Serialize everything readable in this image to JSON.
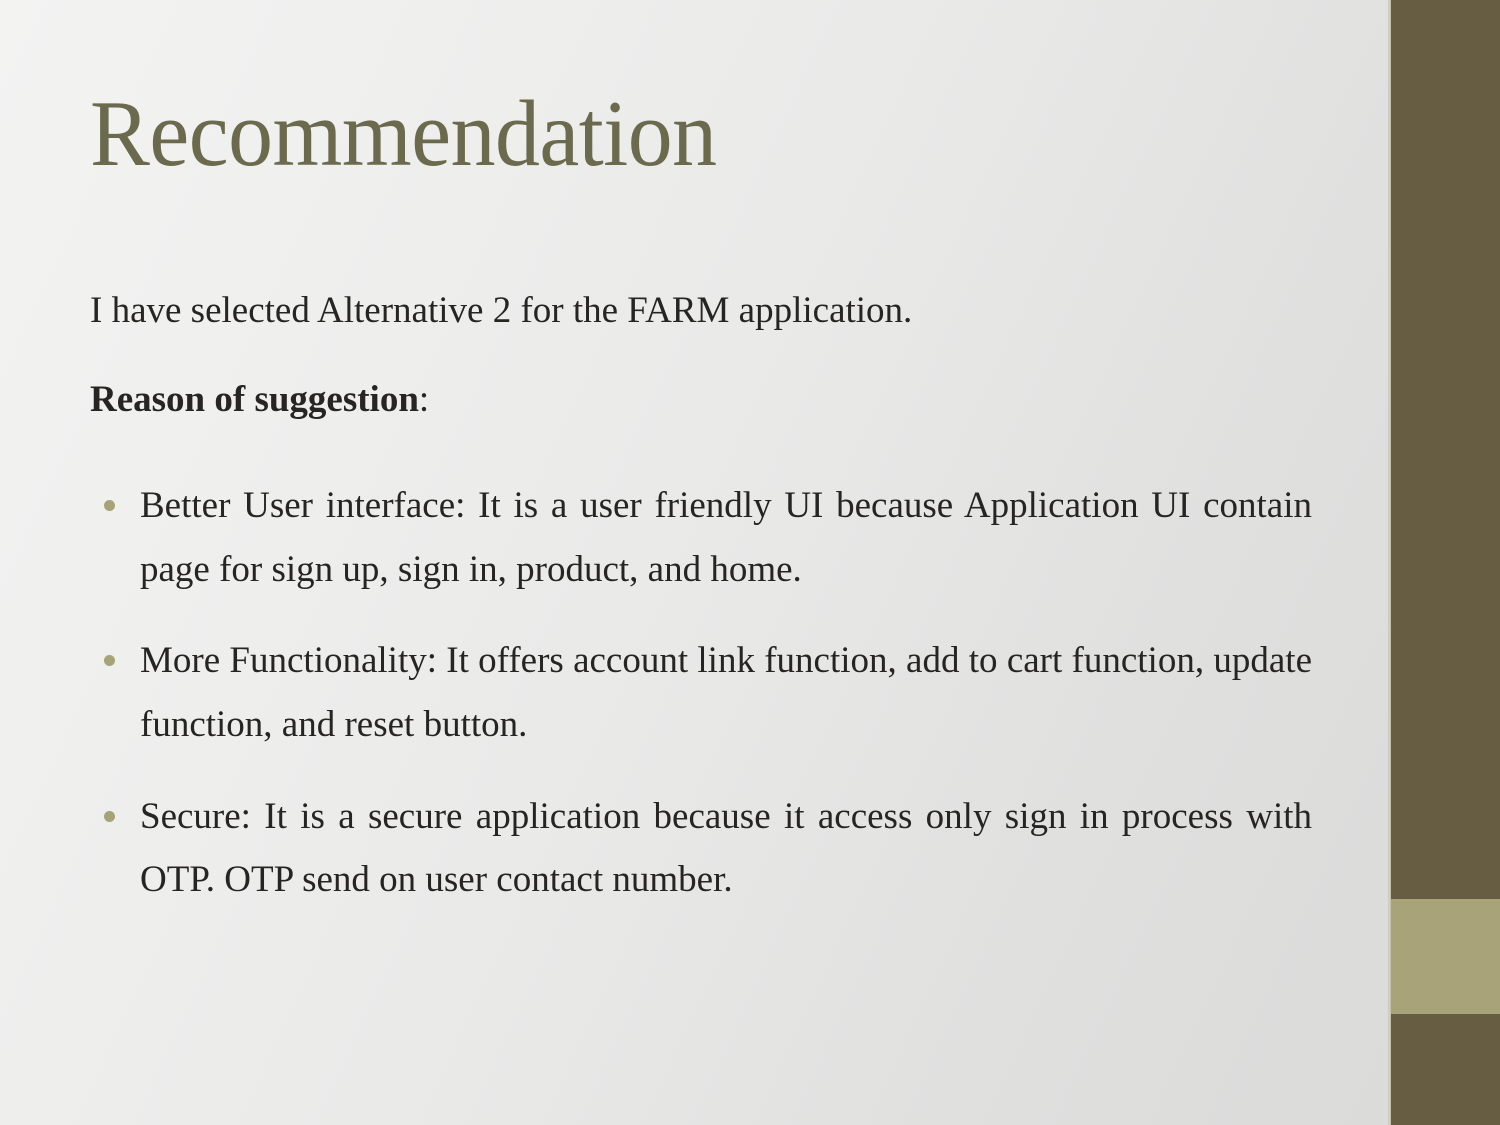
{
  "slide": {
    "title": "Recommendation",
    "lead_paragraph": "I have selected Alternative 2 for the FARM application.",
    "reason_heading_bold": "Reason of suggestion",
    "reason_heading_colon": ":",
    "bullets": [
      "Better User interface: It is a user friendly UI because Application UI contain page for sign up, sign in, product, and home.",
      "More Functionality:  It offers account link function, add to cart function, update function, and reset button.",
      "Secure: It is a secure application because it access only sign in process with OTP. OTP  send on user contact number."
    ]
  },
  "theme": {
    "title_color": "#6b6a4e",
    "body_text_color": "#262523",
    "bullet_color": "#a5a377",
    "band_dark_color": "#665d43",
    "band_accent_color": "#a8a379",
    "background_light": "#f3f3f2",
    "background_shade": "#dadad9"
  }
}
